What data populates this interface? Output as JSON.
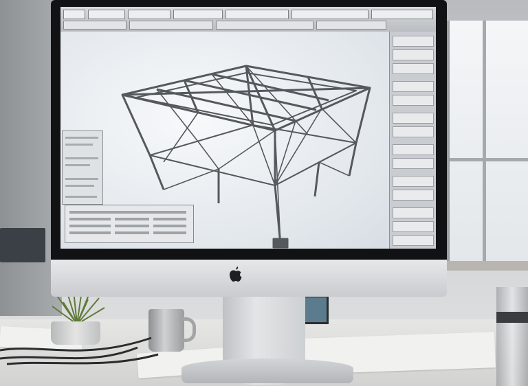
{
  "scene": {
    "description_type": "photo of a desktop computer showing a 3D CAD model of a steel truss structure",
    "colors": {
      "bezel": "#111214",
      "chin": "#e3e4e6",
      "viewport": "#eef1f4",
      "steel": "#5e6368",
      "panel": "#c9ccd0"
    }
  },
  "monitor": {
    "logo_icon": "apple-logo-icon"
  },
  "cad_app": {
    "toolbar_icons": [
      "select-icon",
      "move-icon",
      "rotate-icon",
      "zoom-icon",
      "layers-icon",
      "properties-icon"
    ],
    "viewport_model": "steel-truss-frame"
  },
  "desk_items": [
    "plant",
    "mug",
    "pencil-cup",
    "papers",
    "cables"
  ]
}
